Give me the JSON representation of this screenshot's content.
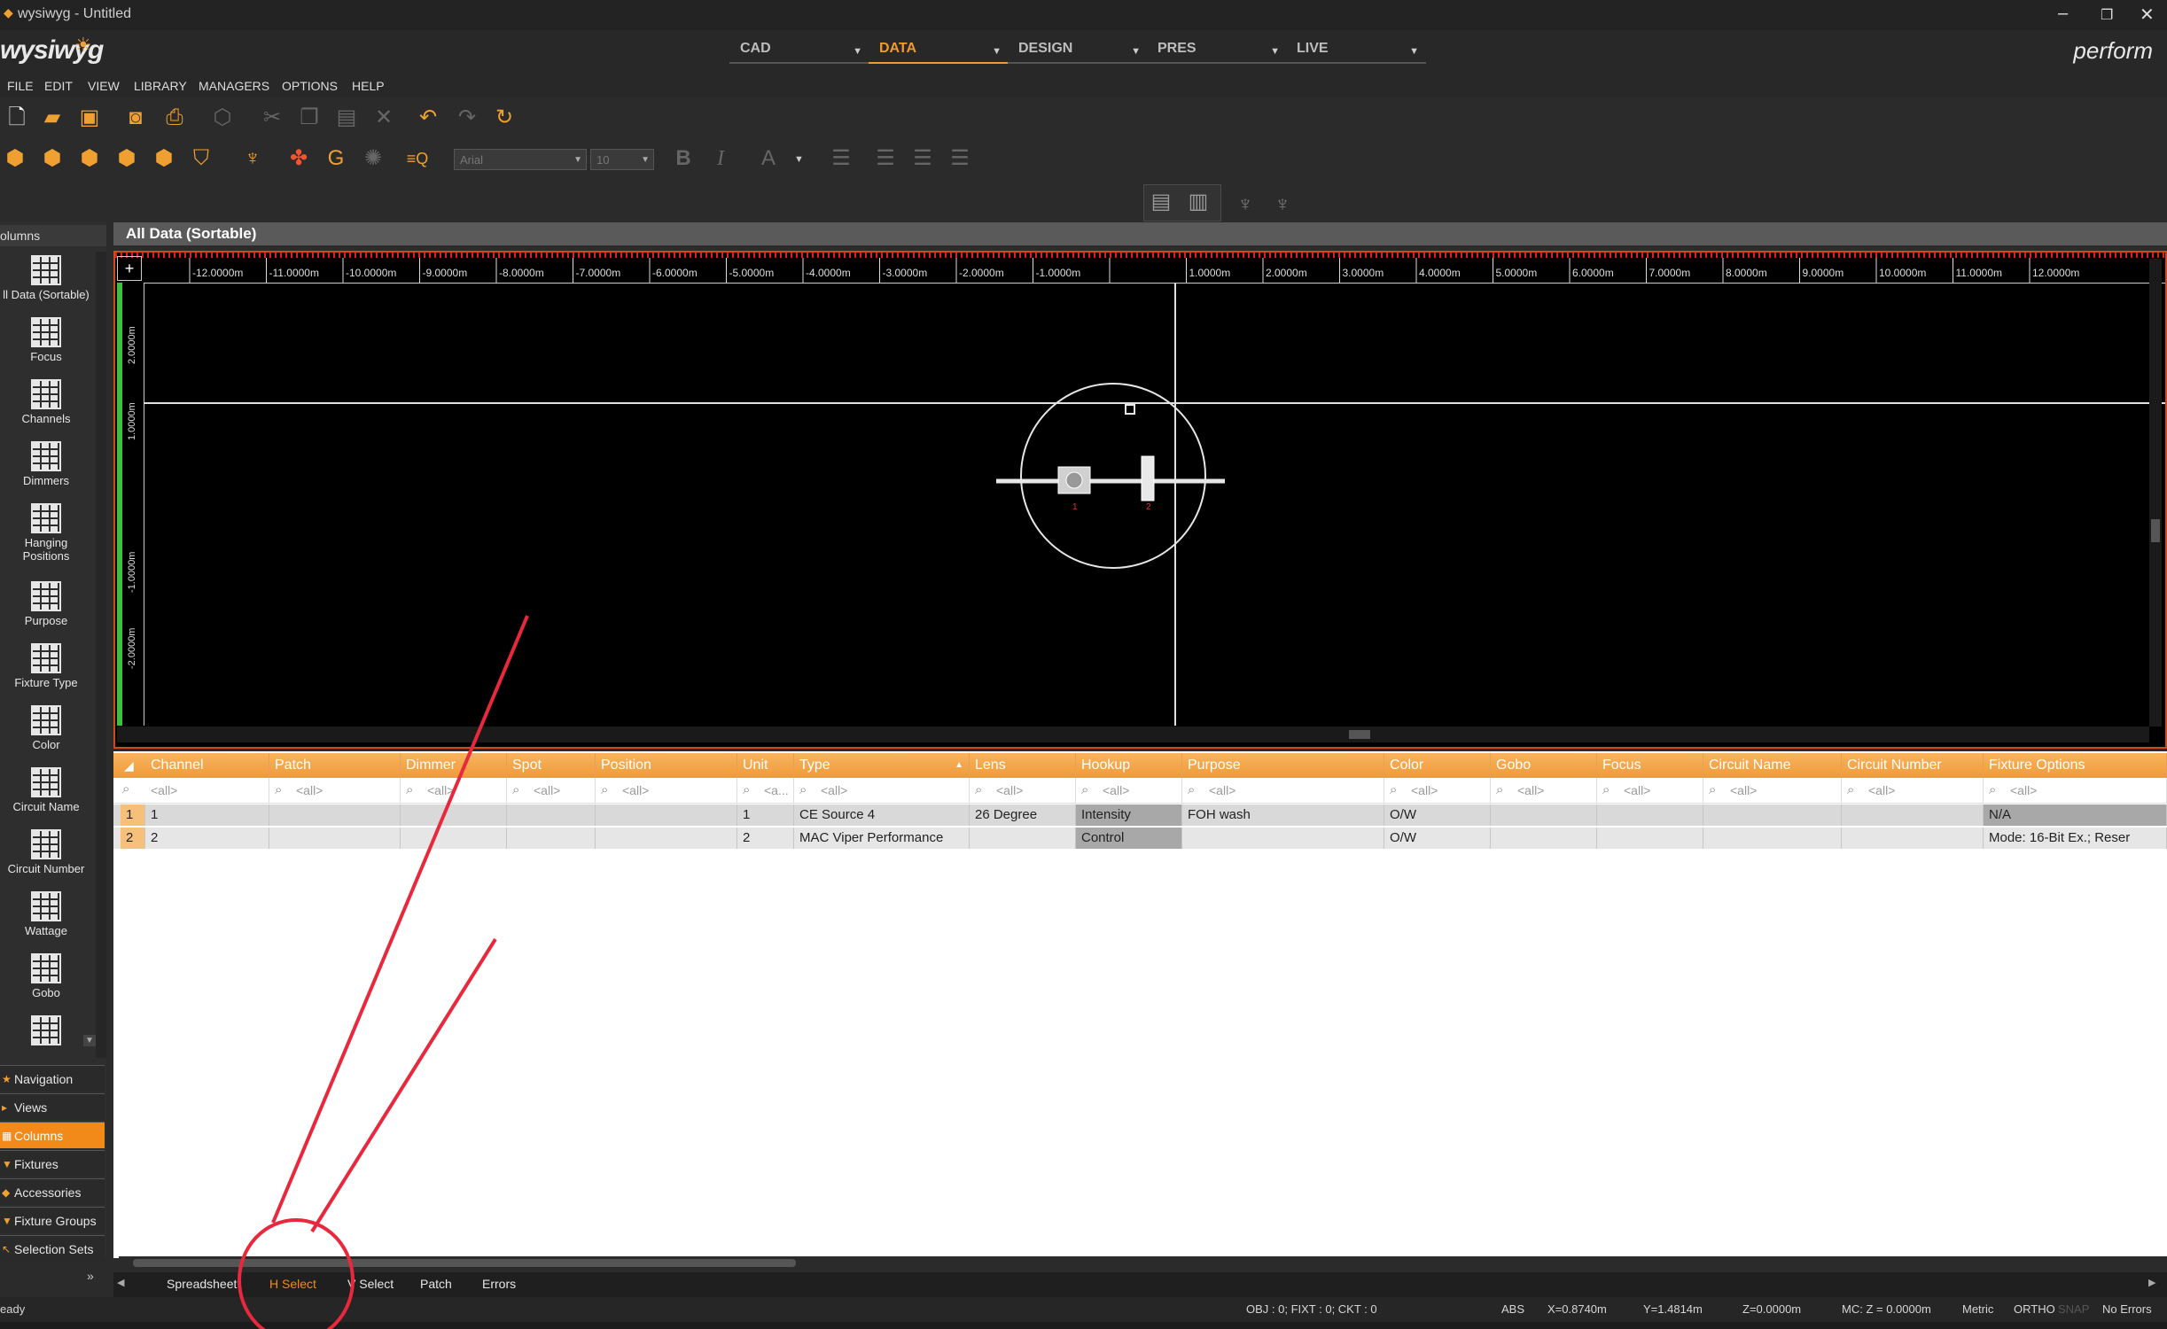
{
  "window": {
    "title": "wysiwyg - Untitled"
  },
  "brand": {
    "logo": "wysiwyg",
    "edition": "perform"
  },
  "mode_tabs": [
    {
      "label": "CAD",
      "active": false
    },
    {
      "label": "DATA",
      "active": true
    },
    {
      "label": "DESIGN",
      "active": false
    },
    {
      "label": "PRES",
      "active": false
    },
    {
      "label": "LIVE",
      "active": false
    }
  ],
  "menu": [
    "FILE",
    "EDIT",
    "VIEW",
    "LIBRARY",
    "MANAGERS",
    "OPTIONS",
    "HELP"
  ],
  "toolbar": {
    "font_name": "Arial",
    "font_size": "10"
  },
  "left_panel": {
    "header": "olumns",
    "columns": [
      "ll Data (Sortable)",
      "Focus",
      "Channels",
      "Dimmers",
      "Hanging Positions",
      "Purpose",
      "Fixture Type",
      "Color",
      "Circuit Name",
      "Circuit Number",
      "Wattage",
      "Gobo"
    ],
    "nav": [
      {
        "label": "Navigation",
        "active": false
      },
      {
        "label": "Views",
        "active": false
      },
      {
        "label": "Columns",
        "active": true
      },
      {
        "label": "Fixtures",
        "active": false
      },
      {
        "label": "Accessories",
        "active": false
      },
      {
        "label": "Fixture Groups",
        "active": false
      },
      {
        "label": "Selection Sets",
        "active": false
      }
    ]
  },
  "main": {
    "title": "All Data (Sortable)"
  },
  "ruler": {
    "h_labels": [
      "-12.0000m",
      "-11.0000m",
      "-10.0000m",
      "-9.0000m",
      "-8.0000m",
      "-7.0000m",
      "-6.0000m",
      "-5.0000m",
      "-4.0000m",
      "-3.0000m",
      "-2.0000m",
      "-1.0000m",
      "",
      "1.0000m",
      "2.0000m",
      "3.0000m",
      "4.0000m",
      "5.0000m",
      "6.0000m",
      "7.0000m",
      "8.0000m",
      "9.0000m",
      "10.0000m",
      "11.0000m",
      "12.0000m"
    ],
    "v_labels": [
      "2.0000m",
      "1.0000m",
      "",
      "-1.0000m",
      "-2.0000m"
    ]
  },
  "grid": {
    "headers": [
      "Channel",
      "Patch",
      "Dimmer",
      "Spot",
      "Position",
      "Unit",
      "Type",
      "Lens",
      "Hookup",
      "Purpose",
      "Color",
      "Gobo",
      "Focus",
      "Circuit Name",
      "Circuit Number",
      "Fixture Options"
    ],
    "filter_value": "<all>",
    "filter_short": "<a...",
    "rows": [
      {
        "num": "1",
        "cells": [
          "1",
          "",
          "",
          "",
          "",
          "1",
          "CE Source 4",
          "26 Degree",
          "Intensity",
          "FOH wash",
          "O/W",
          "",
          "",
          "",
          "",
          "N/A"
        ]
      },
      {
        "num": "2",
        "cells": [
          "2",
          "",
          "",
          "",
          "",
          "2",
          "MAC Viper Performance",
          "",
          "Control",
          "",
          "O/W",
          "",
          "",
          "",
          "",
          "Mode: 16-Bit Ex.; Reser"
        ]
      }
    ]
  },
  "bottom_tabs": [
    {
      "label": "Spreadsheet",
      "active": false
    },
    {
      "label": "H Select",
      "active": true
    },
    {
      "label": "V Select",
      "active": false
    },
    {
      "label": "Patch",
      "active": false
    },
    {
      "label": "Errors",
      "active": false
    }
  ],
  "status": {
    "left": "eady",
    "counts": "OBJ : 0; FIXT : 0; CKT : 0",
    "abs": "ABS",
    "x": "X=0.8740m",
    "y": "Y=1.4814m",
    "z": "Z=0.0000m",
    "mc": "MC: Z = 0.0000m",
    "units": "Metric",
    "ortho": "ORTHO",
    "snap": "SNAP",
    "errors": "No Errors"
  },
  "colors": {
    "accent": "#f28a1a",
    "header_orange": "#f09a38",
    "annotation_red": "#e8283c"
  }
}
